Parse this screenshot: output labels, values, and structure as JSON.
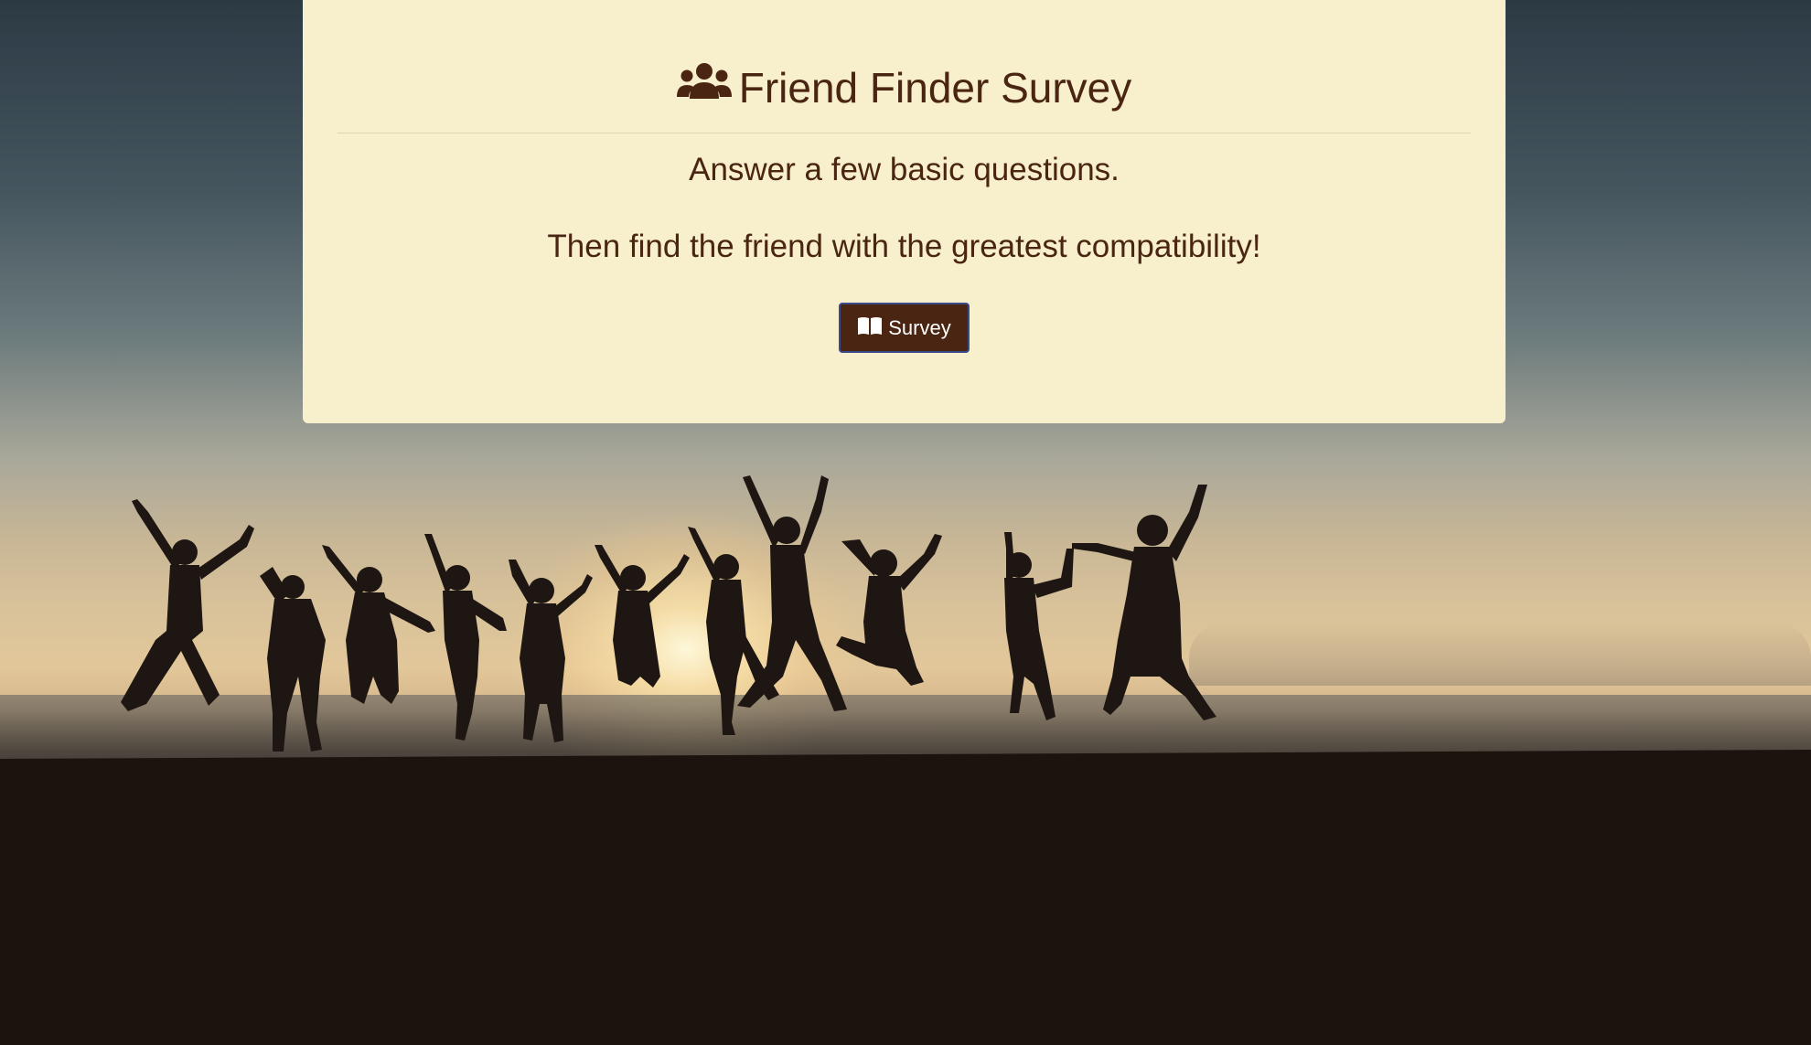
{
  "page": {
    "title": "Friend Finder Survey",
    "title_icon": "users-icon",
    "lead_line_1": "Answer a few basic questions.",
    "lead_line_2": "Then find the friend with the greatest compatibility!",
    "button": {
      "label": "Survey",
      "icon": "book-open-icon"
    }
  },
  "colors": {
    "card_background": "#f8efcc",
    "text_brown": "#4a2512",
    "button_background": "#4a2512",
    "button_text": "#ffffff"
  },
  "background_image": "silhouettes of a group of people jumping on a beach at sunset"
}
